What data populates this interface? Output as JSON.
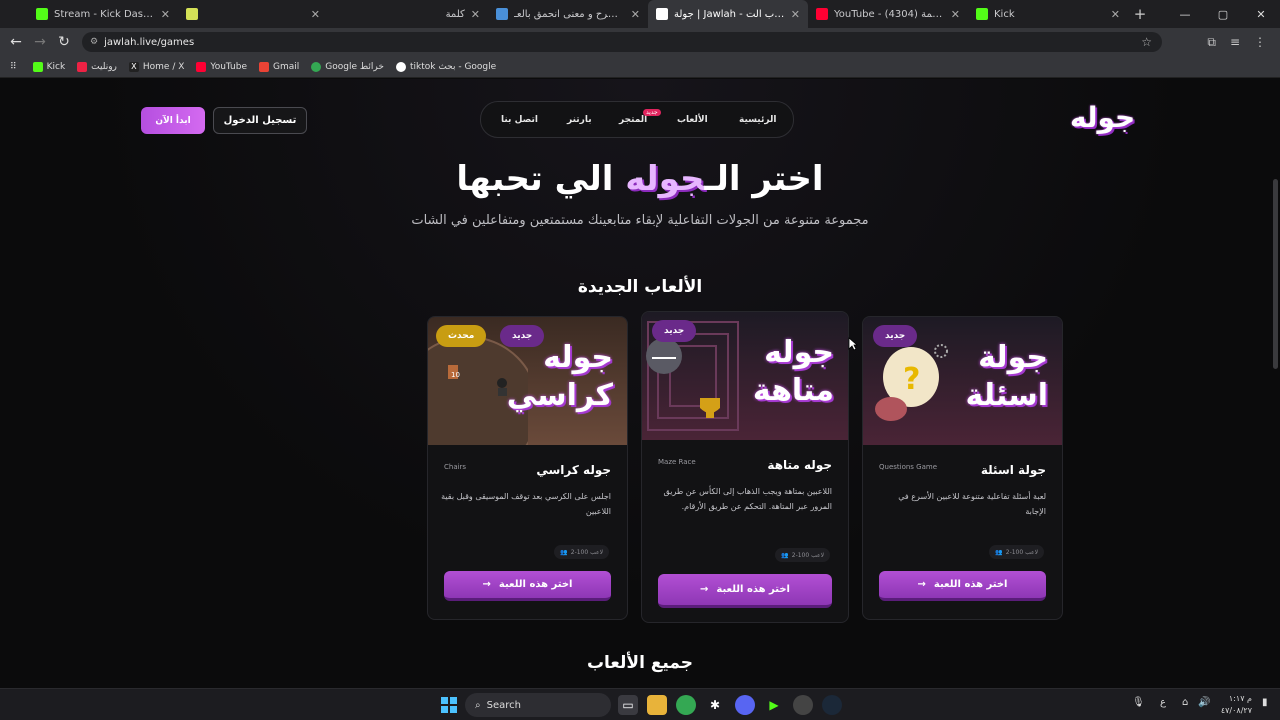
{
  "browser": {
    "tabs": [
      {
        "label": "Stream - Kick Dashboard",
        "color": "#53fc18",
        "active": false
      },
      {
        "label": "",
        "color": "#d4e157",
        "active": false
      },
      {
        "label": "كلمة",
        "color": "",
        "active": false
      },
      {
        "label": "تعريف و شرح و معنى انحمق بالعـ...",
        "color": "#4a90d9",
        "active": false
      },
      {
        "label": "جولة | Jawlah - منصة الألعاب الت...",
        "color": "#ffffff",
        "active": true
      },
      {
        "label": "YouTube - ترنيمة (4304)",
        "color": "#ff0033",
        "active": false
      },
      {
        "label": "Kick",
        "color": "#53fc18",
        "active": false
      }
    ],
    "url": "jawlah.live/games",
    "bookmarks": [
      {
        "label": "Kick",
        "color": "#53fc18"
      },
      {
        "label": "رونليت",
        "color": "#e24"
      },
      {
        "label": "Home / X",
        "color": "#222"
      },
      {
        "label": "YouTube",
        "color": "#ff0033"
      },
      {
        "label": "Gmail",
        "color": "#ea4335"
      },
      {
        "label": "Google خرائط",
        "color": "#34a853"
      },
      {
        "label": "tiktok بحث - Google",
        "color": "#fff"
      }
    ]
  },
  "site": {
    "logo": "جوله",
    "nav": {
      "home": "الرئيسية",
      "games": "الألعاب",
      "store": "المتجر",
      "store_badge": "جديد",
      "partner": "بارتنر",
      "contact": "اتصل بنا"
    },
    "login": "تسجيل الدخول",
    "start": "ابدأ الآن",
    "hero_before": "اختر الـ",
    "hero_accent": "جوله",
    "hero_after": " الي تحبها",
    "subtitle": "مجموعة متنوعة من الجولات التفاعلية لإبقاء متابعينك مستمتعين ومتفاعلين في الشات",
    "new_games_title": "الألعاب الجديدة",
    "all_games_title": "جميع الألعاب"
  },
  "cards": [
    {
      "art": "جولة\nاسئلة",
      "tag_new": "جديد",
      "title": "جولة اسئلة",
      "en": "Questions Game",
      "desc": "لعبة أسئلة تفاعلية متنوعة للاعبين الأسرع في الإجابة",
      "players": "2-100 لاعب",
      "button": "اختر هذه اللعبة",
      "accent": "#9b3fc8"
    },
    {
      "art": "جوله\nمتاهة",
      "tag_new": "جديد",
      "title": "جوله متاهة",
      "en": "Maze Race",
      "desc": "اللاعبين بمتاهة ويجب الذهاب إلى الكأس عن طريق المرور عبر المتاهة. التحكم عن طريق الأرقام.",
      "players": "2-100 لاعب",
      "button": "اختر هذه اللعبة",
      "accent": "#9b3fc8"
    },
    {
      "art": "جوله\nكراسي",
      "tag_new": "جديد",
      "tag_updated": "محدث",
      "title": "جوله كراسي",
      "en": "Chairs",
      "desc": "اجلس على الكرسي بعد توقف الموسيقى وقبل بقية اللاعبين",
      "players": "2-100 لاعب",
      "button": "اختر هذه اللعبة",
      "accent": "#9b3fc8"
    }
  ],
  "taskbar": {
    "search": "Search",
    "time": "م ١:١٧",
    "date": "٤٧/٠٨/٢٧",
    "lang": "ع"
  }
}
